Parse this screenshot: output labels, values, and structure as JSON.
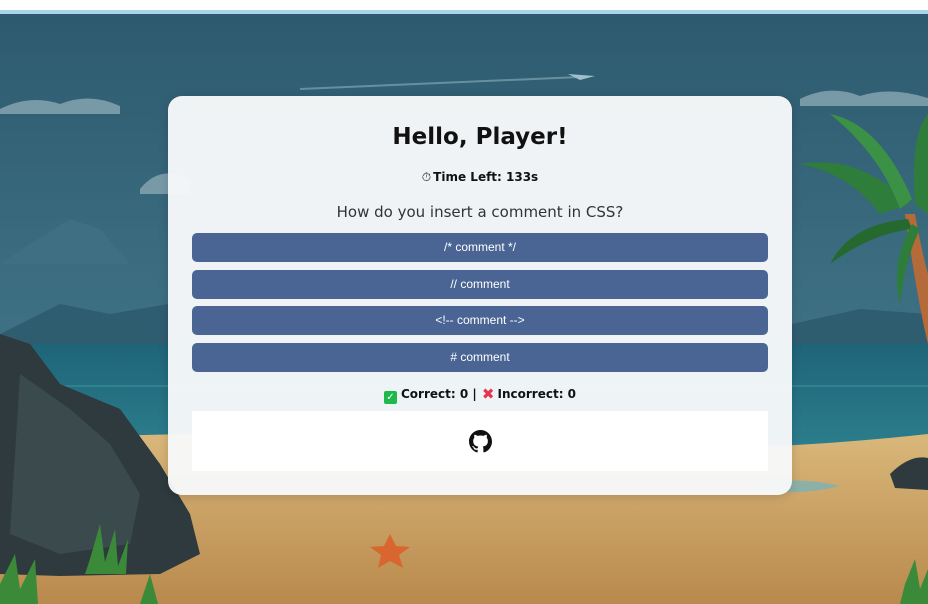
{
  "greeting": {
    "title": "Hello, Player!"
  },
  "timer": {
    "icon": "stopwatch-icon",
    "label": "Time Left: 133s"
  },
  "quiz": {
    "question": "How do you insert a comment in CSS?",
    "options": [
      {
        "label": "/* comment */"
      },
      {
        "label": "// comment"
      },
      {
        "label": "<!-- comment -->"
      },
      {
        "label": "# comment"
      }
    ]
  },
  "score": {
    "correct_icon": "check-box-icon",
    "correct_label": "Correct: 0 |",
    "incorrect_icon": "cross-icon",
    "incorrect_label": "Incorrect: 0"
  },
  "footer": {
    "link_icon": "github-icon"
  },
  "colors": {
    "option_button": "#4a6594",
    "correct": "#1fb84d",
    "incorrect": "#e8334d"
  }
}
